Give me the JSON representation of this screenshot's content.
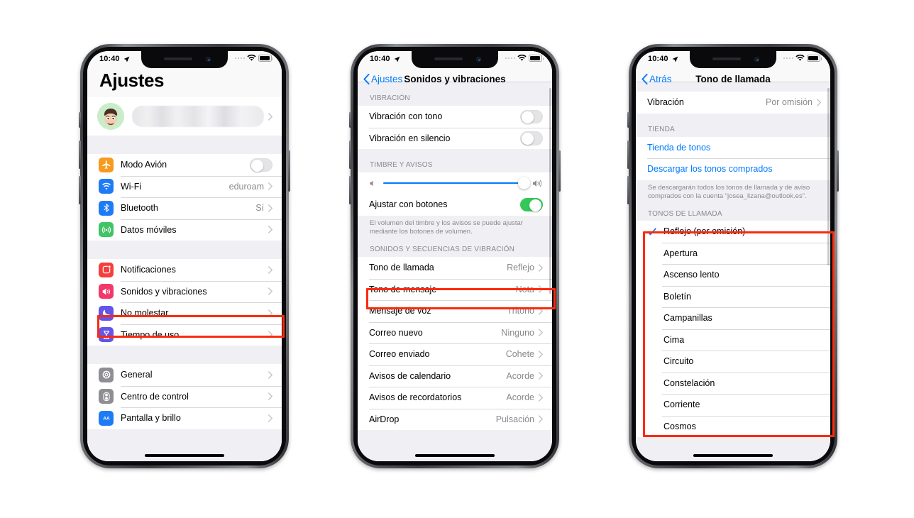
{
  "phones": [
    {
      "name": "settings-main",
      "status_bar": {
        "time": "10:40",
        "location_icon": "location-arrow-icon",
        "wifi_icon": "wifi-icon",
        "battery_icon": "battery-icon"
      },
      "page_title": "Ajustes",
      "profile": {
        "avatar": "memoji-avatar",
        "name_blurred": ""
      },
      "groups": [
        {
          "rows": [
            {
              "label": "Modo Avión",
              "icon": "airplane-icon",
              "icon_color": "#f79a1e",
              "control": "toggle",
              "toggle_on": false
            },
            {
              "label": "Wi-Fi",
              "icon": "wifi-icon",
              "icon_color": "#1e7bf6",
              "value": "eduroam",
              "control": "chevron"
            },
            {
              "label": "Bluetooth",
              "icon": "bluetooth-icon",
              "icon_color": "#1e7bf6",
              "value": "Sí",
              "control": "chevron"
            },
            {
              "label": "Datos móviles",
              "icon": "cellular-icon",
              "icon_color": "#41c463",
              "value": "",
              "control": "chevron"
            }
          ]
        },
        {
          "rows": [
            {
              "label": "Notificaciones",
              "icon": "notification-icon",
              "icon_color": "#f43f3f",
              "value": "",
              "control": "chevron"
            },
            {
              "label": "Sonidos y vibraciones",
              "icon": "speaker-icon",
              "icon_color": "#f2386b",
              "value": "",
              "control": "chevron",
              "highlighted": true
            },
            {
              "label": "No molestar",
              "icon": "moon-icon",
              "icon_color": "#6355e8",
              "value": "",
              "control": "chevron"
            },
            {
              "label": "Tiempo de uso",
              "icon": "hourglass-icon",
              "icon_color": "#6355e8",
              "value": "",
              "control": "chevron"
            }
          ]
        },
        {
          "rows": [
            {
              "label": "General",
              "icon": "gear-icon",
              "icon_color": "#8e8e93",
              "value": "",
              "control": "chevron"
            },
            {
              "label": "Centro de control",
              "icon": "control-center-icon",
              "icon_color": "#8e8e93",
              "value": "",
              "control": "chevron"
            },
            {
              "label": "Pantalla y brillo",
              "icon": "display-icon",
              "icon_color": "#1e7bf6",
              "value": "",
              "control": "chevron"
            }
          ]
        }
      ]
    },
    {
      "name": "sounds-and-vibration",
      "status_bar": {
        "time": "10:40",
        "location_icon": "location-arrow-icon",
        "wifi_icon": "wifi-icon",
        "battery_icon": "battery-icon"
      },
      "nav": {
        "back_label": "Ajustes",
        "title": "Sonidos y vibraciones"
      },
      "section_1_header": "VIBRACIÓN",
      "section_1_rows": [
        {
          "label": "Vibración con tono",
          "control": "toggle",
          "toggle_on": false
        },
        {
          "label": "Vibración en silencio",
          "control": "toggle",
          "toggle_on": false
        }
      ],
      "section_2_header": "TIMBRE Y AVISOS",
      "volume_slider": {
        "value_percent": 97,
        "min_icon": "speaker-min-icon",
        "max_icon": "speaker-max-icon"
      },
      "section_2_rows": [
        {
          "label": "Ajustar con botones",
          "control": "toggle",
          "toggle_on": true
        }
      ],
      "section_2_footnote": "El volumen del timbre y los avisos se puede ajustar mediante los botones de volumen.",
      "section_3_header": "SONIDOS Y SECUENCIAS DE VIBRACIÓN",
      "section_3_rows": [
        {
          "label": "Tono de llamada",
          "value": "Reflejo",
          "control": "chevron",
          "highlighted": true
        },
        {
          "label": "Tono de mensaje",
          "value": "Nota",
          "control": "chevron"
        },
        {
          "label": "Mensaje de voz",
          "value": "Tritono",
          "control": "chevron"
        },
        {
          "label": "Correo nuevo",
          "value": "Ninguno",
          "control": "chevron"
        },
        {
          "label": "Correo enviado",
          "value": "Cohete",
          "control": "chevron"
        },
        {
          "label": "Avisos de calendario",
          "value": "Acorde",
          "control": "chevron"
        },
        {
          "label": "Avisos de recordatorios",
          "value": "Acorde",
          "control": "chevron"
        },
        {
          "label": "AirDrop",
          "value": "Pulsación",
          "control": "chevron"
        }
      ]
    },
    {
      "name": "ringtone-picker",
      "status_bar": {
        "time": "10:40",
        "location_icon": "location-arrow-icon",
        "wifi_icon": "wifi-icon",
        "battery_icon": "battery-icon"
      },
      "nav": {
        "back_label": "Atrás",
        "title": "Tono de llamada"
      },
      "vibration_row": {
        "label": "Vibración",
        "value": "Por omisión",
        "control": "chevron"
      },
      "store_header": "TIENDA",
      "store_rows": [
        {
          "label": "Tienda de tonos",
          "link": true
        },
        {
          "label": "Descargar los tonos comprados",
          "link": true
        }
      ],
      "store_footnote": "Se descargarán todos los tonos de llamada y de aviso comprados con la cuenta “josea_lizana@outlook.es”.",
      "ringtones_header": "TONOS DE LLAMADA",
      "ringtones": [
        {
          "label": "Reflejo (por omisión)",
          "selected": true
        },
        {
          "label": "Apertura",
          "selected": false
        },
        {
          "label": "Ascenso lento",
          "selected": false
        },
        {
          "label": "Boletín",
          "selected": false
        },
        {
          "label": "Campanillas",
          "selected": false
        },
        {
          "label": "Cima",
          "selected": false
        },
        {
          "label": "Circuito",
          "selected": false
        },
        {
          "label": "Constelación",
          "selected": false
        },
        {
          "label": "Corriente",
          "selected": false
        },
        {
          "label": "Cosmos",
          "selected": false
        }
      ]
    }
  ],
  "annotation": {
    "highlight_color": "#fc2a0e",
    "accent_blue": "#007aff",
    "toggle_on_green": "#34c759"
  }
}
